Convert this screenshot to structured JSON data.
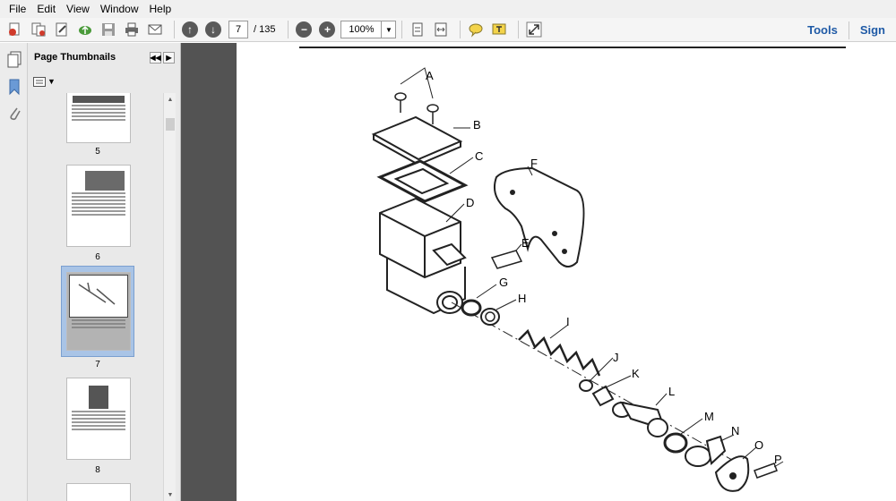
{
  "menu": [
    "File",
    "Edit",
    "View",
    "Window",
    "Help"
  ],
  "toolbar": {
    "current_page": "7",
    "total_pages": "/ 135",
    "zoom": "100%",
    "tools_label": "Tools",
    "sign_label": "Sign"
  },
  "thumbnails": {
    "title": "Page Thumbnails",
    "pages": [
      "5",
      "6",
      "7",
      "8"
    ]
  },
  "diagram": {
    "labels": [
      "A",
      "B",
      "C",
      "D",
      "E",
      "F",
      "G",
      "H",
      "I",
      "J",
      "K",
      "L",
      "M",
      "N",
      "O",
      "P"
    ]
  }
}
